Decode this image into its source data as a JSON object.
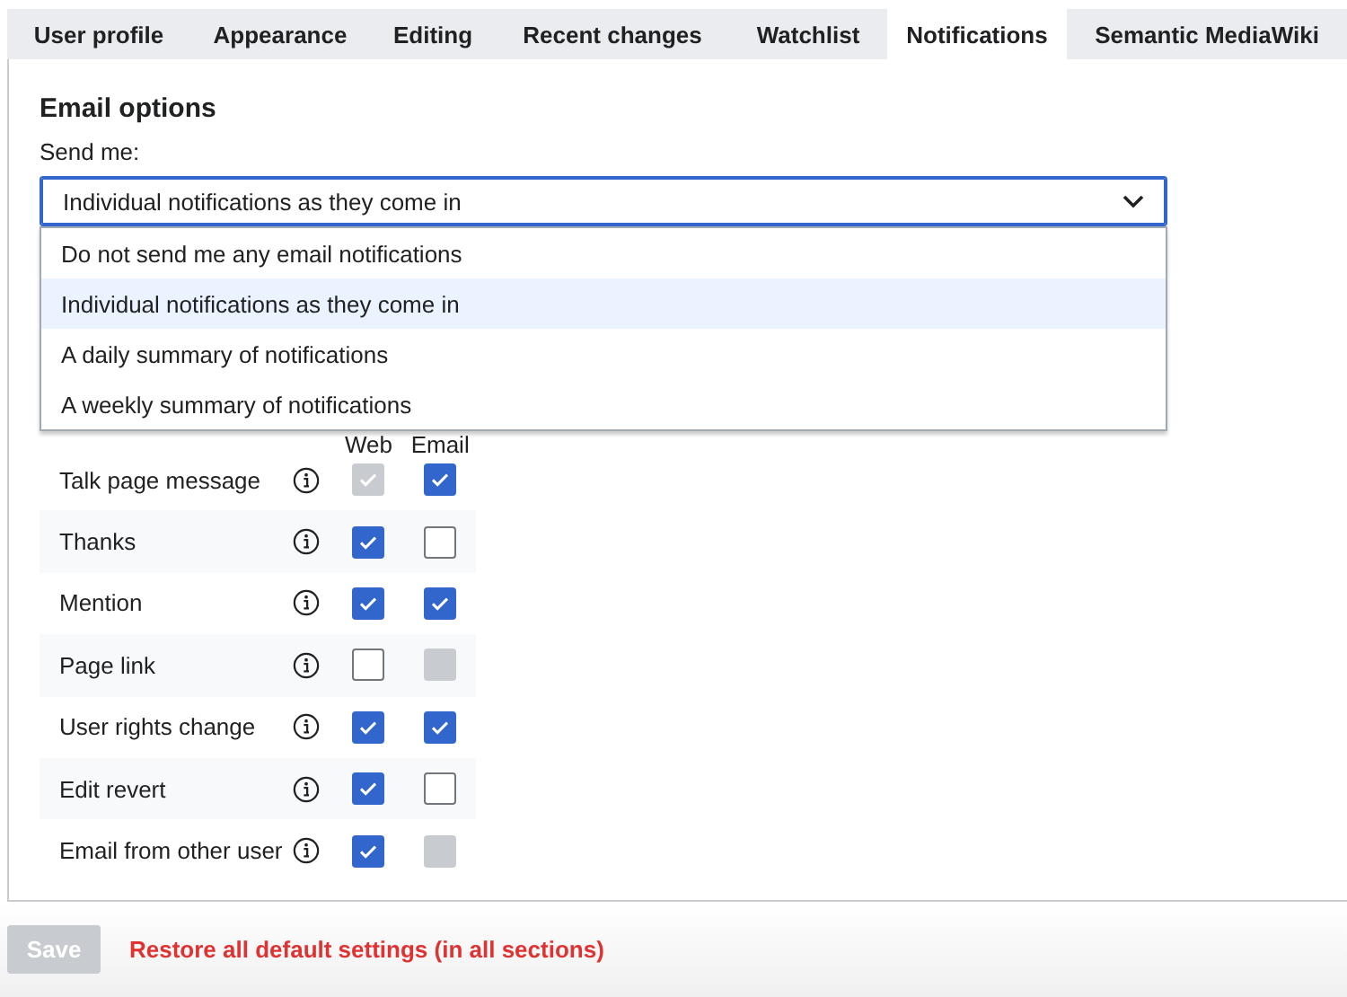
{
  "tabs": [
    {
      "label": "User profile",
      "selected": false
    },
    {
      "label": "Appearance",
      "selected": false
    },
    {
      "label": "Editing",
      "selected": false
    },
    {
      "label": "Recent changes",
      "selected": false
    },
    {
      "label": "Watchlist",
      "selected": false
    },
    {
      "label": "Notifications",
      "selected": true
    },
    {
      "label": "Semantic MediaWiki",
      "selected": false
    }
  ],
  "section": {
    "title": "Email options",
    "field_label": "Send me:",
    "value": "Individual notifications as they come in",
    "options": [
      {
        "label": "Do not send me any email notifications",
        "selected": false
      },
      {
        "label": "Individual notifications as they come in",
        "selected": true
      },
      {
        "label": "A daily summary of notifications",
        "selected": false
      },
      {
        "label": "A weekly summary of notifications",
        "selected": false
      }
    ]
  },
  "table": {
    "columns": [
      "Web",
      "Email"
    ],
    "rows": [
      {
        "label": "Talk page message",
        "web": {
          "checked": true,
          "disabled": true
        },
        "email": {
          "checked": true,
          "disabled": false
        }
      },
      {
        "label": "Thanks",
        "web": {
          "checked": true,
          "disabled": false
        },
        "email": {
          "checked": false,
          "disabled": false
        }
      },
      {
        "label": "Mention",
        "web": {
          "checked": true,
          "disabled": false
        },
        "email": {
          "checked": true,
          "disabled": false
        }
      },
      {
        "label": "Page link",
        "web": {
          "checked": false,
          "disabled": false
        },
        "email": {
          "checked": false,
          "disabled": true
        }
      },
      {
        "label": "User rights change",
        "web": {
          "checked": true,
          "disabled": false
        },
        "email": {
          "checked": true,
          "disabled": false
        }
      },
      {
        "label": "Edit revert",
        "web": {
          "checked": true,
          "disabled": false
        },
        "email": {
          "checked": false,
          "disabled": false
        }
      },
      {
        "label": "Email from other user",
        "web": {
          "checked": true,
          "disabled": false
        },
        "email": {
          "checked": false,
          "disabled": true
        }
      }
    ]
  },
  "footer": {
    "save": {
      "label": "Save",
      "disabled": true
    },
    "restore_link": "Restore all default settings (in all sections)"
  }
}
